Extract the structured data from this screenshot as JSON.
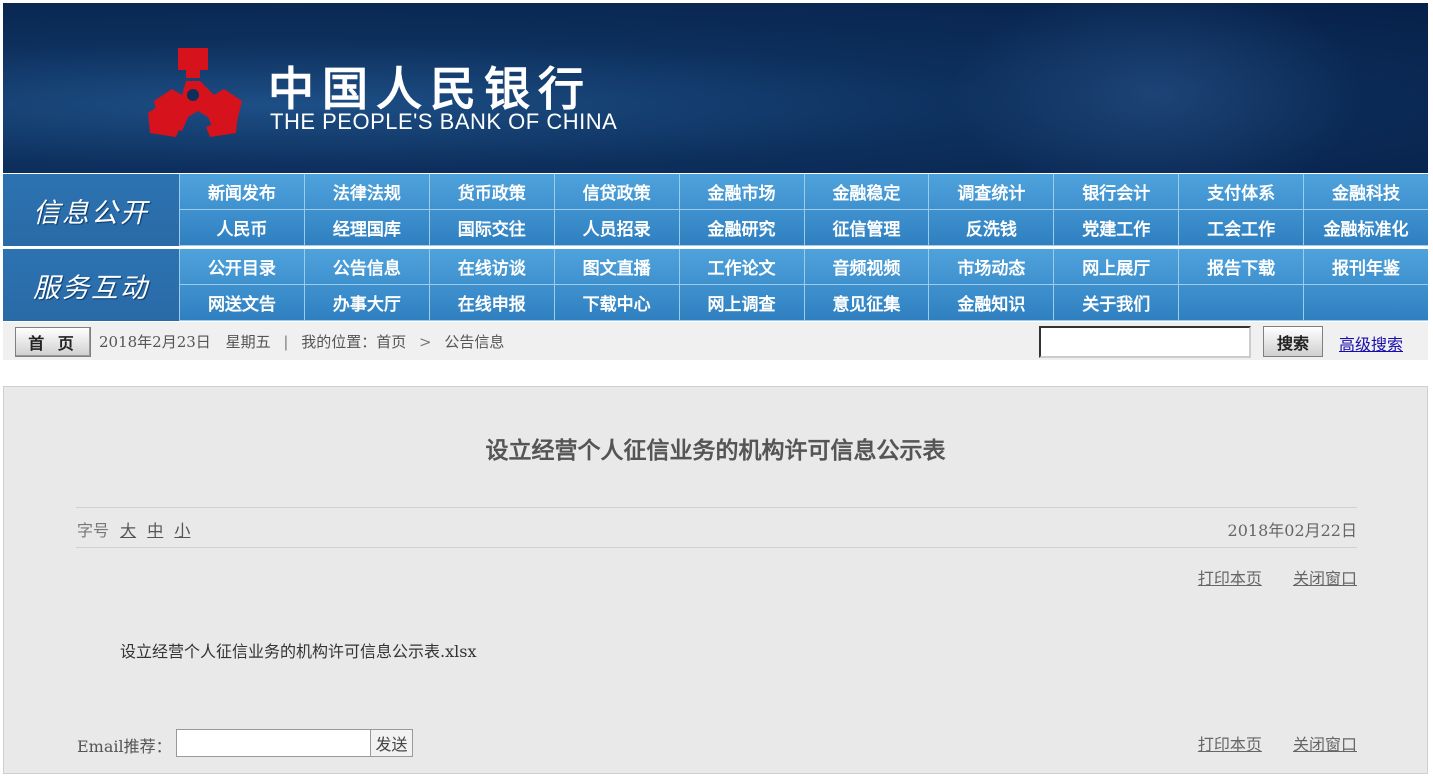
{
  "banner": {
    "logo_cn": "中国人民银行",
    "logo_en": "THE PEOPLE'S BANK OF CHINA",
    "emblem_color": "#d6121c"
  },
  "nav": {
    "info": {
      "label": "信息公开",
      "items": [
        "新闻发布",
        "法律法规",
        "货币政策",
        "信贷政策",
        "金融市场",
        "金融稳定",
        "调查统计",
        "银行会计",
        "支付体系",
        "金融科技",
        "人民币",
        "经理国库",
        "国际交往",
        "人员招录",
        "金融研究",
        "征信管理",
        "反洗钱",
        "党建工作",
        "工会工作",
        "金融标准化"
      ]
    },
    "service": {
      "label": "服务互动",
      "items": [
        "公开目录",
        "公告信息",
        "在线访谈",
        "图文直播",
        "工作论文",
        "音频视频",
        "市场动态",
        "网上展厅",
        "报告下载",
        "报刊年鉴",
        "网送文告",
        "办事大厅",
        "在线申报",
        "下载中心",
        "网上调查",
        "意见征集",
        "金融知识",
        "关于我们",
        "",
        ""
      ]
    }
  },
  "locbar": {
    "home": "首 页",
    "date": "2018年2月23日",
    "weekday": "星期五",
    "divider": "|",
    "location_prefix": "我的位置：首页",
    "arrow": ">",
    "current": "公告信息",
    "search_button": "搜索",
    "advanced_search": "高级搜索",
    "search_value": ""
  },
  "article": {
    "title": "设立经营个人征信业务的机构许可信息公示表",
    "font_label": "字号",
    "font_large": "大",
    "font_medium": "中",
    "font_small": "小",
    "date": "2018年02月22日",
    "print": "打印本页",
    "close": "关闭窗口",
    "attachment": "设立经营个人征信业务的机构许可信息公示表.xlsx",
    "email_label": "Email推荐：",
    "email_value": "",
    "send": "发送"
  }
}
